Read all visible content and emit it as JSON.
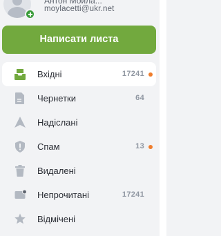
{
  "account": {
    "name": "Антон Мойла...",
    "email": "moylacetti@ukr.net"
  },
  "compose": {
    "label": "Написати листа"
  },
  "folders": [
    {
      "id": "inbox",
      "label": "Вхідні",
      "count": "17241",
      "unread_dot": true,
      "icon": "inbox-icon",
      "active": true
    },
    {
      "id": "drafts",
      "label": "Чернетки",
      "count": "64",
      "unread_dot": false,
      "icon": "document-icon",
      "active": false
    },
    {
      "id": "sent",
      "label": "Надіслані",
      "count": "",
      "unread_dot": false,
      "icon": "send-icon",
      "active": false
    },
    {
      "id": "spam",
      "label": "Спам",
      "count": "13",
      "unread_dot": true,
      "icon": "spam-shield-icon",
      "active": false
    },
    {
      "id": "deleted",
      "label": "Видалені",
      "count": "",
      "unread_dot": false,
      "icon": "trash-icon",
      "active": false
    },
    {
      "id": "unread",
      "label": "Непрочитані",
      "count": "17241",
      "unread_dot": false,
      "icon": "unread-mail-icon",
      "active": false
    },
    {
      "id": "starred",
      "label": "Відмічені",
      "count": "",
      "unread_dot": false,
      "icon": "star-icon",
      "active": false
    }
  ],
  "colors": {
    "accent": "#72a93e",
    "unread_dot": "#ef7d2c",
    "avatar_badge": "#3a9c3a",
    "icon_inactive": "#b3b9c2"
  }
}
